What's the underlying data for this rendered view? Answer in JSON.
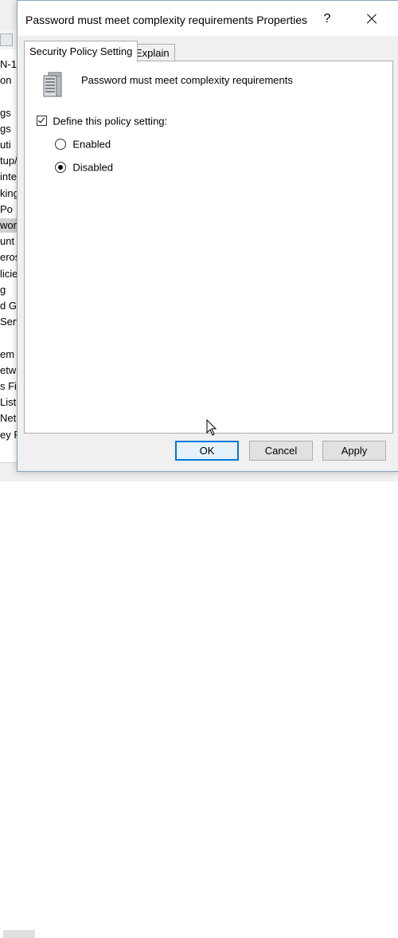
{
  "background": {
    "tree_items": [
      "N-1",
      "on",
      "",
      "gs",
      "gs",
      "uti",
      "tup/",
      "inte",
      "king",
      " Po",
      "wor",
      "unt",
      "eros",
      "licie",
      "g",
      "d G",
      "Serv",
      "",
      "em",
      "etw",
      "s Fi",
      " List",
      " Net",
      "ey Pe"
    ],
    "selected_index": 10
  },
  "dialog": {
    "title": "Password must meet complexity requirements Properties",
    "help_label": "?",
    "tabs": [
      {
        "label": "Security Policy Setting",
        "active": true
      },
      {
        "label": "Explain",
        "active": false
      }
    ],
    "policy_title": "Password must meet complexity requirements",
    "define_checkbox": {
      "label": "Define this policy setting:",
      "checked": true
    },
    "options": [
      {
        "label": "Enabled",
        "checked": false
      },
      {
        "label": "Disabled",
        "checked": true
      }
    ],
    "buttons": {
      "ok": "OK",
      "cancel": "Cancel",
      "apply": "Apply"
    }
  },
  "colors": {
    "accent": "#0078d7",
    "dialog_bg": "#f0f0f0",
    "panel_bg": "#ffffff"
  },
  "icons": [
    "server-policy-icon",
    "close-icon",
    "mouse-cursor-icon"
  ]
}
